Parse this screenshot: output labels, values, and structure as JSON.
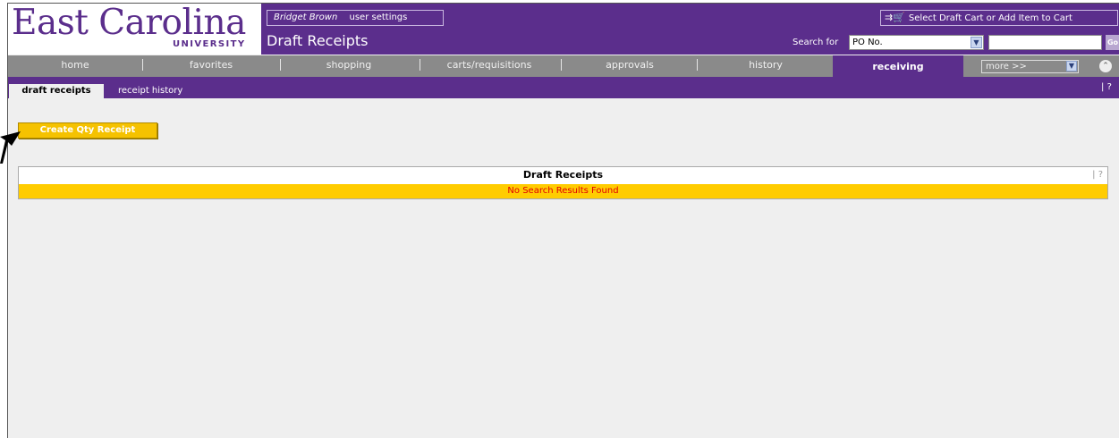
{
  "brand": {
    "logo_main": "East Carolina",
    "logo_sub": "UNIVERSITY"
  },
  "user": {
    "name": "Bridget Brown",
    "settings_label": "user settings"
  },
  "page_title": "Draft Receipts",
  "cart": {
    "label": "Select Draft Cart or Add Item to Cart"
  },
  "search": {
    "label": "Search for",
    "selected": "PO No.",
    "input_value": "",
    "go_label": "Go"
  },
  "nav": {
    "items": [
      "home",
      "favorites",
      "shopping",
      "carts/requisitions",
      "approvals",
      "history"
    ],
    "active": "receiving",
    "more_label": "more >>"
  },
  "subnav": {
    "active": "draft receipts",
    "other": "receipt history",
    "help": "?"
  },
  "content": {
    "create_button": "Create Qty Receipt",
    "table_title": "Draft Receipts",
    "table_help": "?",
    "no_results": "No Search Results Found"
  },
  "colors": {
    "brand_purple": "#5b2e8c",
    "nav_gray": "#8a8a8a",
    "highlight_yellow": "#ffcc00",
    "error_red": "#e00000"
  }
}
